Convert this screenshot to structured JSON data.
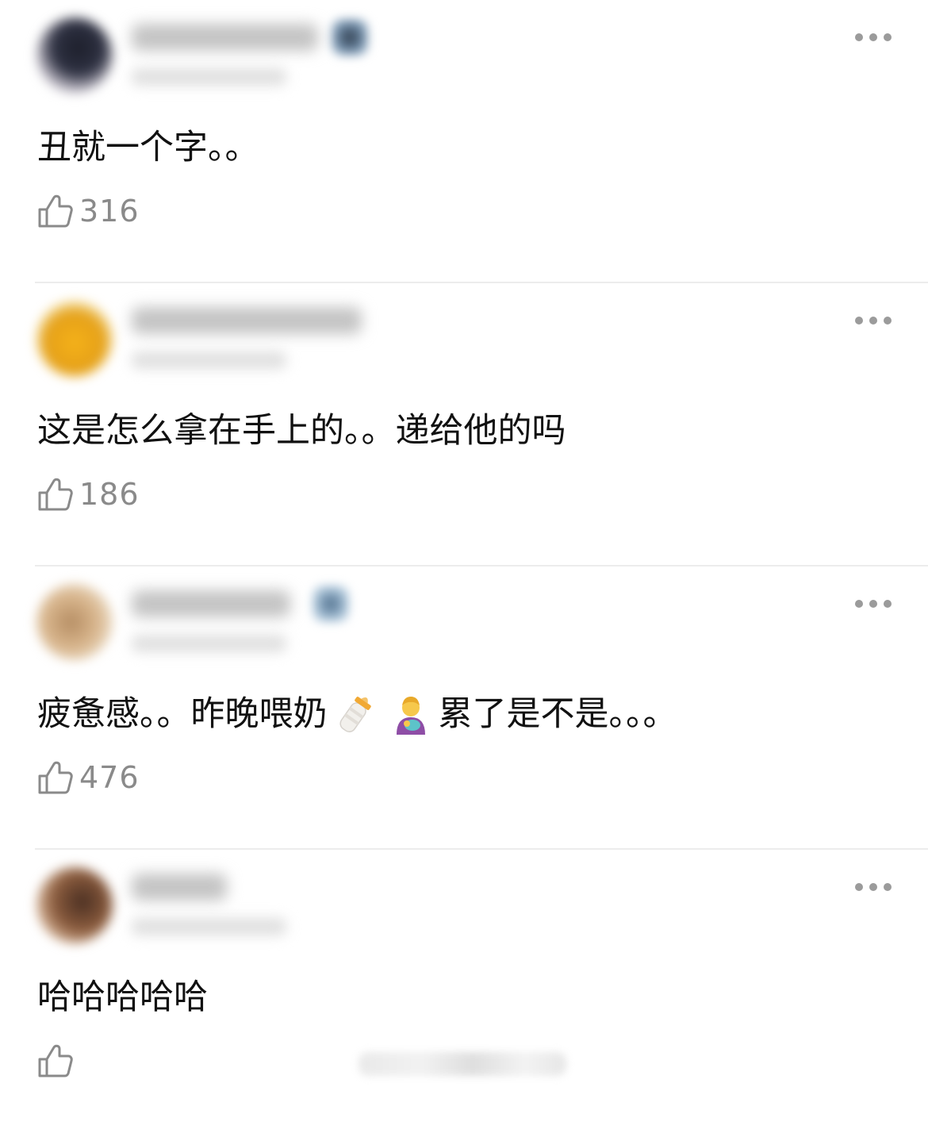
{
  "comments": [
    {
      "text": "丑就一个字。。",
      "likes": "316",
      "username_blurred": true,
      "avatar_colors": [
        "#1d1f2b",
        "#f3eef3"
      ]
    },
    {
      "text": "这是怎么拿在手上的。。递给他的吗",
      "likes": "186",
      "username_blurred": true,
      "avatar_colors": [
        "#f5b21a",
        "#fdf7e6"
      ]
    },
    {
      "text_before_emoji": "疲惫感。。昨晚喂奶",
      "emojis": [
        "baby-bottle-icon",
        "man-feeding-baby-icon"
      ],
      "text_after_emoji": "累了是不是。。。",
      "likes": "476",
      "username_blurred": true,
      "avatar_colors": [
        "#b58d63",
        "#f7f1ea"
      ]
    },
    {
      "text": "哈哈哈哈哈",
      "likes": "",
      "username_blurred": true,
      "avatar_colors": [
        "#4a2f22",
        "#f4ebe2"
      ]
    }
  ],
  "colors": {
    "like_count": "#8a8a8a",
    "more_dots": "#9b9b9b",
    "divider": "#ececec",
    "text": "#111111"
  },
  "icons": {
    "like": "thumbs-up-icon",
    "more": "more-horizontal-icon"
  }
}
